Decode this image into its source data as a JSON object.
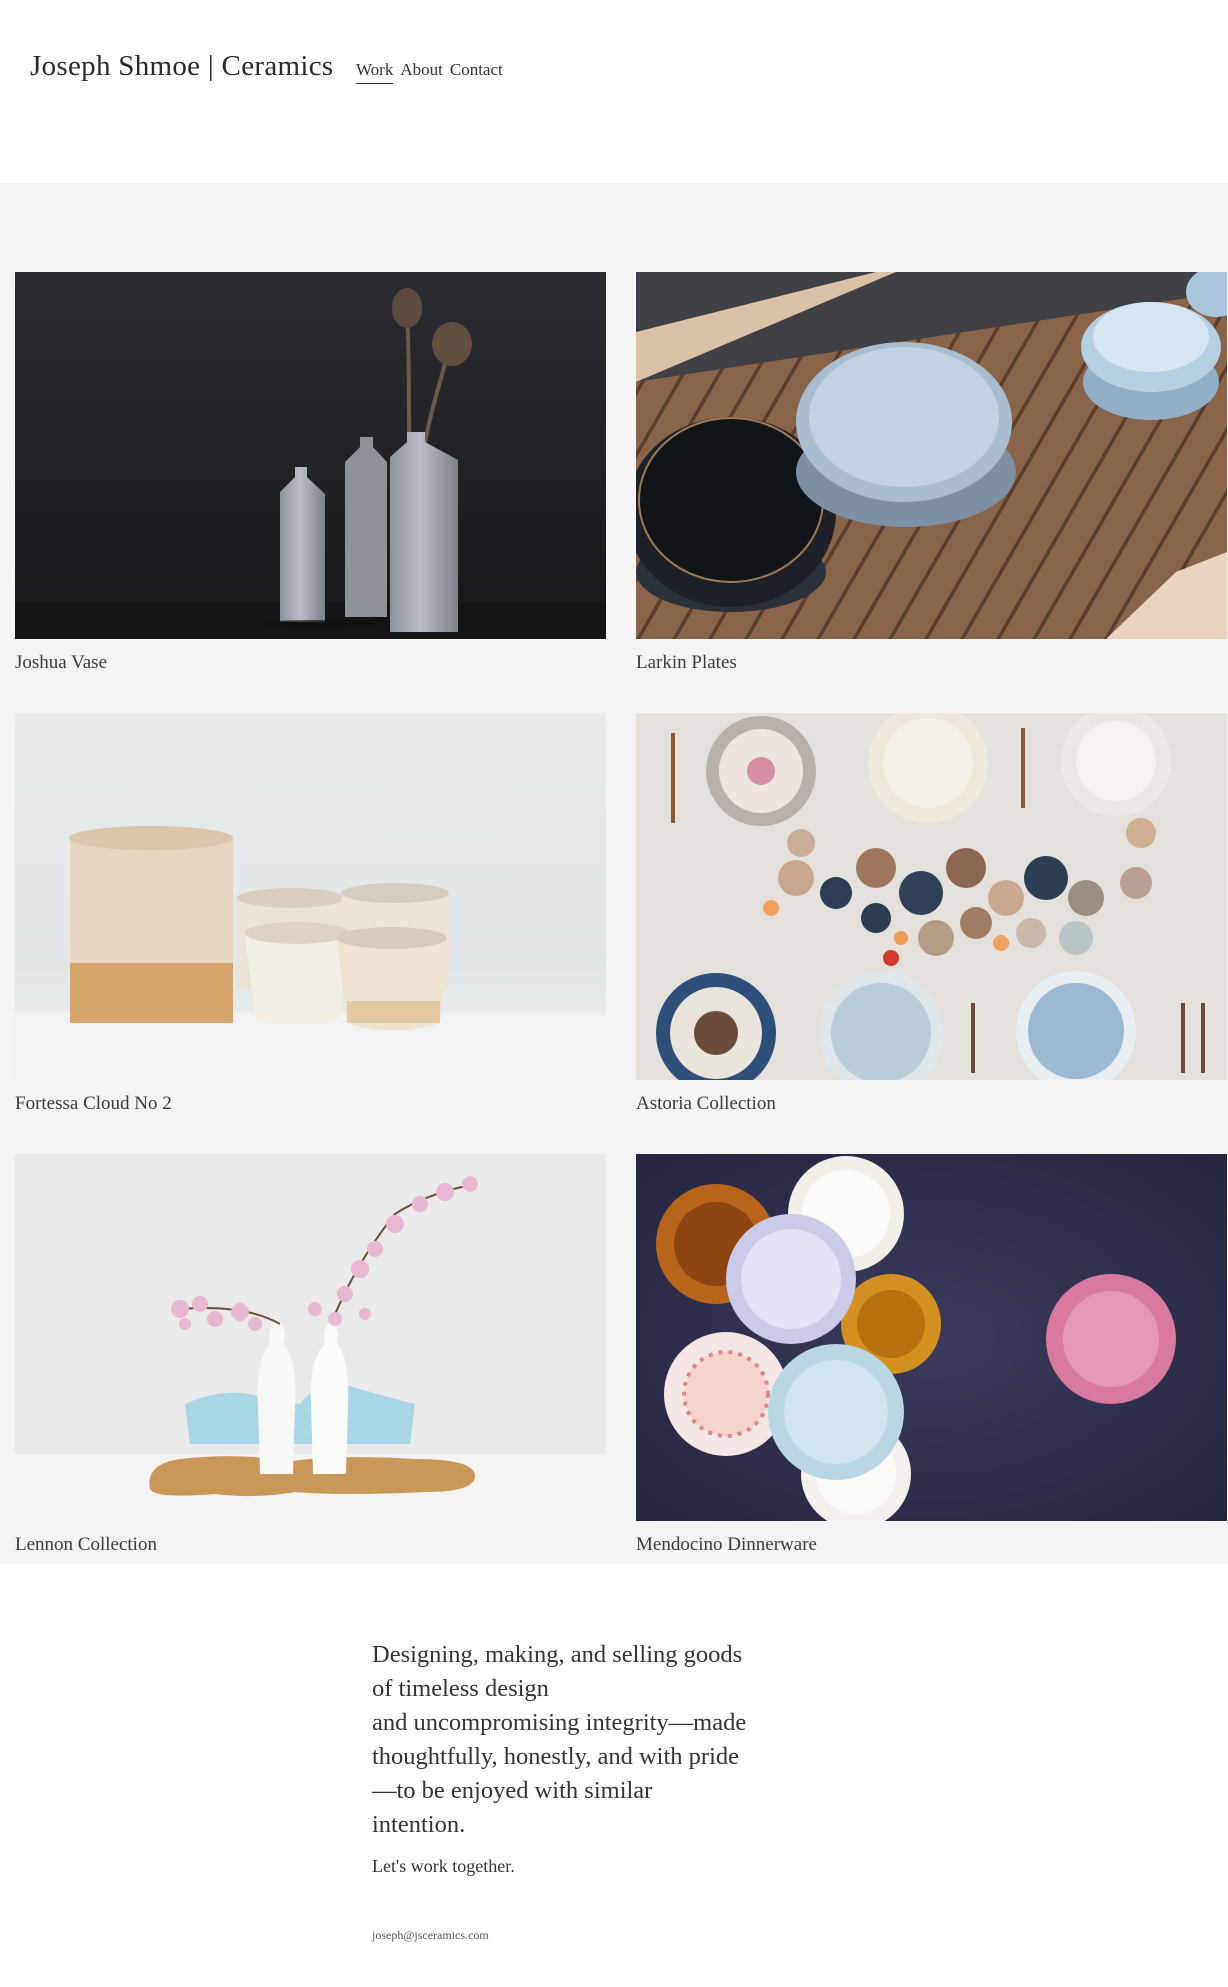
{
  "header": {
    "site_title": "Joseph Shmoe | Ceramics",
    "nav": [
      {
        "label": "Work",
        "active": true
      },
      {
        "label": "About",
        "active": false
      },
      {
        "label": "Contact",
        "active": false
      }
    ]
  },
  "gallery": {
    "items": [
      {
        "caption": "Joshua Vase",
        "image": "ceramic-bottles-dark-background"
      },
      {
        "caption": "Larkin Plates",
        "image": "stacked-plates-and-bowls-on-wood"
      },
      {
        "caption": "Fortessa Cloud No 2",
        "image": "speckled-cups-white-background"
      },
      {
        "caption": "Astoria Collection",
        "image": "table-setting-with-pumpkins"
      },
      {
        "caption": "Lennon Collection",
        "image": "white-vases-with-blossoms"
      },
      {
        "caption": "Mendocino Dinnerware",
        "image": "vintage-plates-on-navy"
      }
    ]
  },
  "about": {
    "lines": [
      "Designing, making, and selling goods",
      "of timeless design",
      "and uncompromising integrity—made",
      "thoughtfully, honestly, and with pride",
      "—to be enjoyed with similar",
      "intention."
    ],
    "cta": "Let's work together.",
    "email": "joseph@jsceramics.com"
  },
  "colors": {
    "gallery_background": "#f4f4f4",
    "text": "#333333"
  }
}
